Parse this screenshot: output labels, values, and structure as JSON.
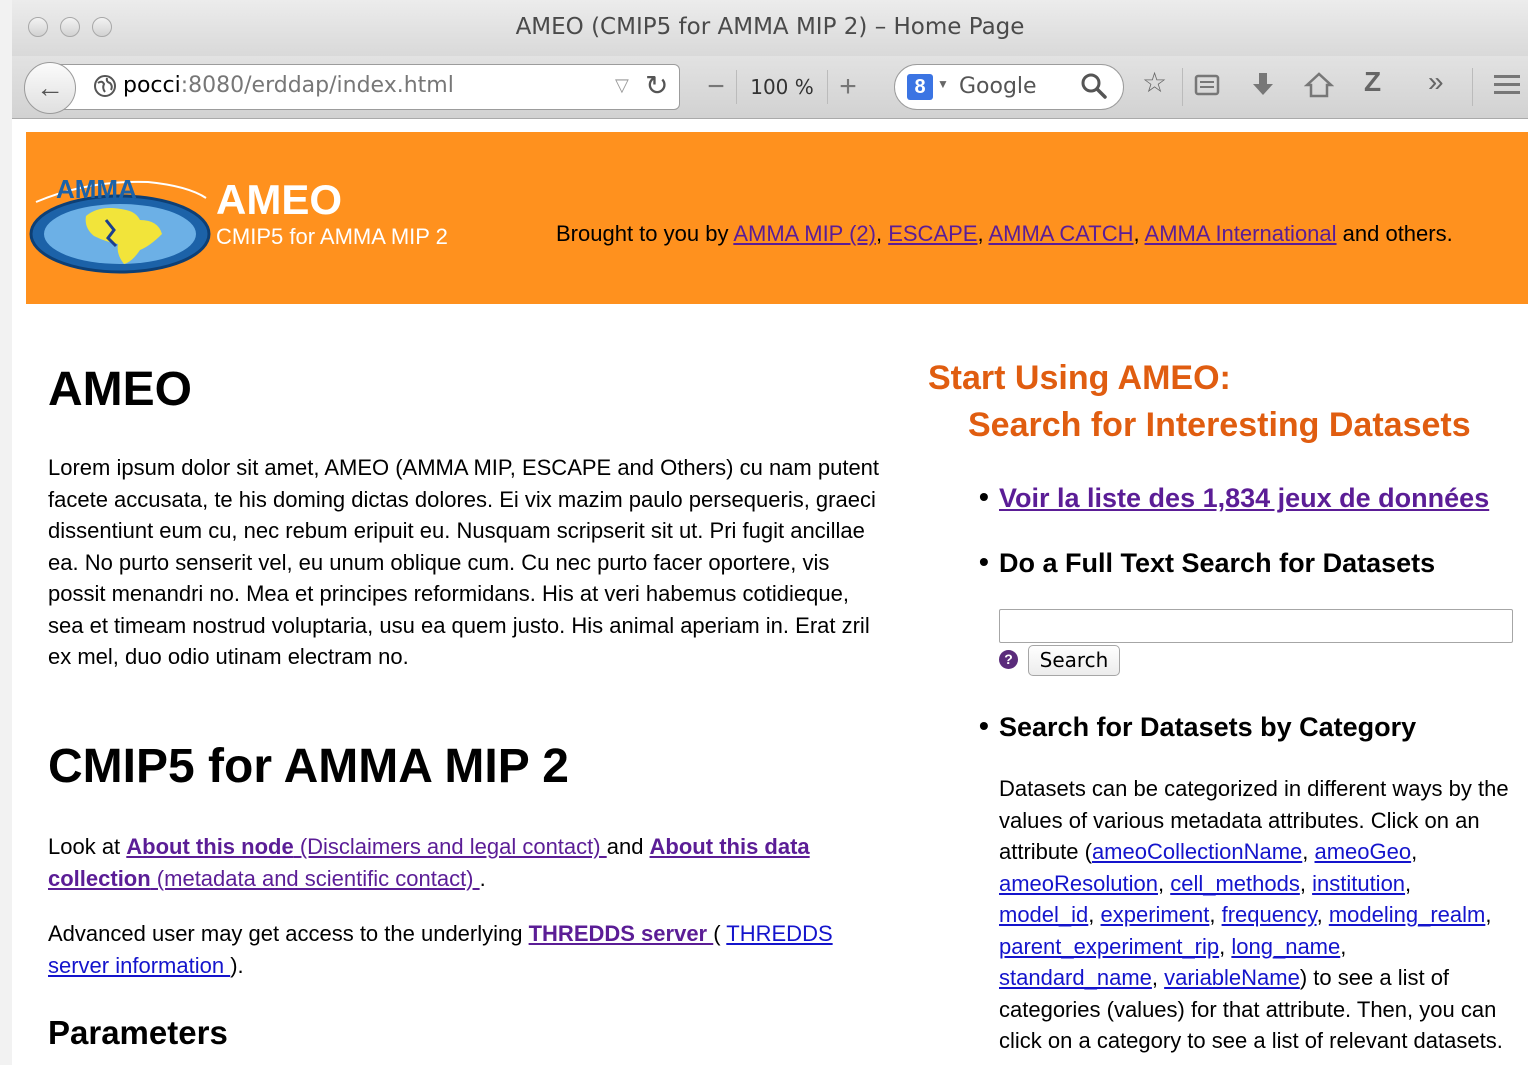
{
  "window": {
    "title": "AMEO (CMIP5 for AMMA MIP 2) – Home Page"
  },
  "toolbar": {
    "url_host": "pocci",
    "url_rest": ":8080/erddap/index.html",
    "zoom": "100 %",
    "search_engine": "Google",
    "search_engine_badge": "8"
  },
  "banner": {
    "logo_text": "AMMA",
    "site_name": "AMEO",
    "site_subtitle": "CMIP5 for AMMA MIP 2",
    "brought_prefix": "Brought to you by ",
    "links": [
      "AMMA MIP (2)",
      "ESCAPE",
      "AMMA CATCH",
      "AMMA International"
    ],
    "sep": ", ",
    "suffix": " and others."
  },
  "main": {
    "heading": "AMEO",
    "intro": "Lorem ipsum dolor sit amet, AMEO (AMMA MIP, ESCAPE and Others) cu nam putent facete accusata, te his doming dictas dolores. Ei vix mazim paulo persequeris, graeci dissentiunt eum cu, nec rebum eripuit eu. Nusquam scripserit sit ut. Pri fugit ancillae ea. No purto senserit vel, eu unum oblique cum. Cu nec purto facer oportere, vis possit menandri no. Mea et principes reformidans. His at veri habemus cotidieque, sea et timeam nostrud voluptaria, usu ea quem justo. His animal aperiam in. Erat zril ex mel, duo odio utinam electram no.",
    "heading2": "CMIP5 for AMMA MIP 2",
    "look_prefix": "Look at ",
    "about_node": "About this node",
    "about_node_sub": " (Disclaimers and legal contact) ",
    "and": "and ",
    "about_collection": "About this data collection",
    "about_collection_sub": " (metadata and scientific contact) ",
    "period": ".",
    "advanced_prefix": "Advanced user may get access to the underlying ",
    "thredds_link": "THREDDS server ",
    "paren_open": "(",
    "thredds_info": "THREDDS server information ",
    "paren_close": ").",
    "parameters_heading": "Parameters"
  },
  "sidebar": {
    "title_line1": "Start Using AMEO:",
    "title_line2": "Search for Interesting Datasets",
    "list_link": "Voir la liste des 1,834 jeux de données",
    "fulltext_heading": "Do a Full Text Search for Datasets",
    "search_button": "Search",
    "help_glyph": "?",
    "category_heading": "Search for Datasets by Category",
    "cat_intro": "Datasets can be categorized in different ways by the values of various metadata attributes. Click on an attribute (",
    "attributes": [
      "ameoCollectionName",
      "ameoGeo",
      "ameoResolution",
      "cell_methods",
      "institution",
      "model_id",
      "experiment",
      "frequency",
      "modeling_realm",
      "parent_experiment_rip",
      "long_name",
      "standard_name",
      "variableName"
    ],
    "cat_outro": ") to see a list of categories (values) for that attribute. Then, you can click on a category to see a list of relevant datasets."
  },
  "colors": {
    "banner": "#ff911e",
    "accent_heading": "#e05d10",
    "link_visited": "#5b1d96",
    "link": "#1414cc"
  }
}
